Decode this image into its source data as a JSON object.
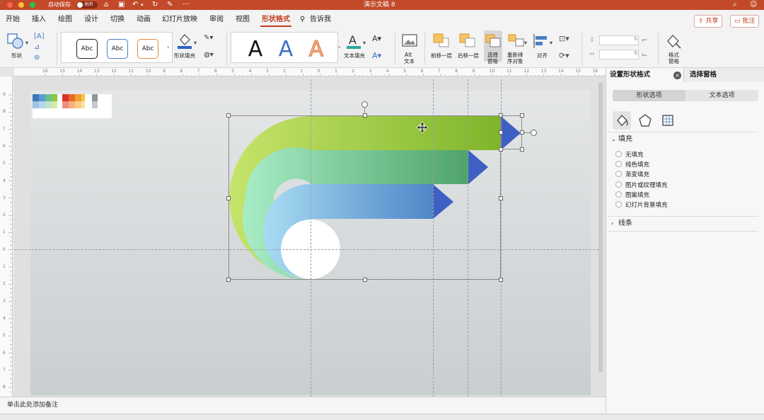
{
  "titlebar": {
    "autosave_label": "自动保存",
    "autosave_state": "关闭",
    "doc_title": "演示文稿 8"
  },
  "tabs": [
    "开始",
    "插入",
    "绘图",
    "设计",
    "切换",
    "动画",
    "幻灯片放映",
    "审阅",
    "视图",
    "形状格式"
  ],
  "tell_me": "告诉我",
  "share_label": "共享",
  "comment_label": "批注",
  "ribbon": {
    "shape_label": "形状",
    "abc": [
      "Abc",
      "Abc",
      "Abc"
    ],
    "shape_fill_label": "形状填充",
    "wordart": [
      "A",
      "A",
      "A"
    ],
    "text_fill_label": "文本填充",
    "alt_text_label_1": "Alt",
    "alt_text_label_2": "文本",
    "bring_forward_label": "前移一层",
    "send_backward_label": "后移一层",
    "select_pane_label_1": "选择",
    "select_pane_label_2": "窗格",
    "reorder_label_1": "重新排",
    "reorder_label_2": "序对象",
    "align_label": "对齐",
    "format_pane_label_1": "格式",
    "format_pane_label_2": "窗格"
  },
  "ruler_h": [
    "16",
    "15",
    "14",
    "13",
    "12",
    "11",
    "10",
    "9",
    "8",
    "7",
    "6",
    "5",
    "4",
    "3",
    "2",
    "1",
    "0",
    "1",
    "2",
    "3",
    "4",
    "5",
    "6",
    "7",
    "8",
    "9",
    "10",
    "11",
    "12",
    "13",
    "14",
    "15",
    "16"
  ],
  "ruler_v": [
    "9",
    "8",
    "7",
    "6",
    "5",
    "4",
    "3",
    "2",
    "1",
    "0",
    "1",
    "2",
    "3",
    "4",
    "5",
    "6",
    "7",
    "8",
    "9"
  ],
  "notes_placeholder": "单击此处添加备注",
  "pane": {
    "title": "设置形状格式",
    "alt_title": "选择窗格",
    "tab_shape": "形状选项",
    "tab_text": "文本选项",
    "fill_section": "填充",
    "fill_options": [
      "无填充",
      "纯色填充",
      "渐变填充",
      "图片或纹理填充",
      "图案填充",
      "幻灯片背景填充"
    ],
    "line_section": "线条"
  },
  "colors": {
    "accent": "#c43e1c",
    "band_green_top": "#b8dc5a",
    "band_mint": "#8fdcb0",
    "band_blue": "#7fbde0",
    "arrow_blue": "#3f63c4"
  }
}
